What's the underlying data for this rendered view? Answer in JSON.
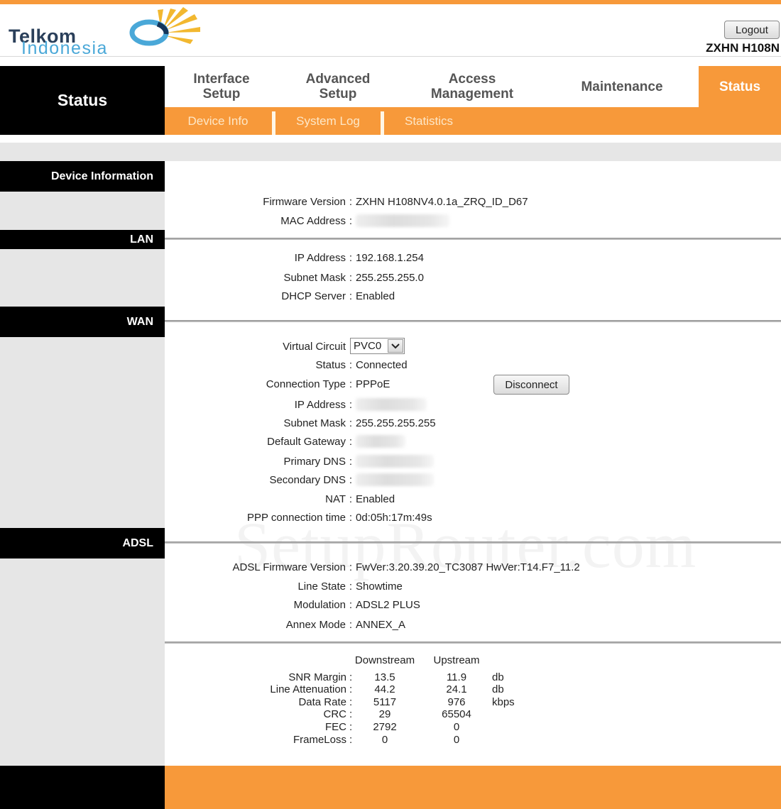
{
  "brand": {
    "line1": "Telkom",
    "line2": "Indonesia",
    "colors": {
      "orange": "#f7993a",
      "black": "#000000",
      "gray_panel": "#e6e6e6",
      "logo_dark": "#2a3f5a",
      "logo_blue": "#4aa8d8",
      "logo_sun": "#f2b830"
    }
  },
  "header": {
    "logout_label": "Logout",
    "model": "ZXHN H108N"
  },
  "nav": {
    "section_title": "Status",
    "tabs": [
      {
        "label": "Interface\nSetup",
        "active": false
      },
      {
        "label": "Advanced\nSetup",
        "active": false
      },
      {
        "label": "Access\nManagement",
        "active": false
      },
      {
        "label": "Maintenance",
        "active": false
      },
      {
        "label": "Status",
        "active": true
      }
    ],
    "subtabs": [
      {
        "label": "Device Info"
      },
      {
        "label": "System Log"
      },
      {
        "label": "Statistics"
      }
    ]
  },
  "sections": {
    "device_information": "Device Information",
    "lan": "LAN",
    "wan": "WAN",
    "adsl": "ADSL"
  },
  "device": {
    "firmware_label": "Firmware Version",
    "firmware_value": "ZXHN H108NV4.0.1a_ZRQ_ID_D67",
    "mac_label": "MAC Address",
    "mac_value": "(blurred)"
  },
  "lan": {
    "ip_label": "IP Address",
    "ip_value": "192.168.1.254",
    "mask_label": "Subnet Mask",
    "mask_value": "255.255.255.0",
    "dhcp_label": "DHCP Server",
    "dhcp_value": "Enabled"
  },
  "wan": {
    "vc_label": "Virtual Circuit",
    "vc_selected": "PVC0",
    "status_label": "Status",
    "status_value": "Connected",
    "conn_type_label": "Connection Type",
    "conn_type_value": "PPPoE",
    "disconnect_label": "Disconnect",
    "ip_label": "IP Address",
    "ip_value": "(blurred)",
    "mask_label": "Subnet Mask",
    "mask_value": "255.255.255.255",
    "gateway_label": "Default Gateway",
    "gateway_value": "(blurred)",
    "dns1_label": "Primary DNS",
    "dns1_value": "(blurred)",
    "dns2_label": "Secondary DNS",
    "dns2_value": "(blurred)",
    "nat_label": "NAT",
    "nat_value": "Enabled",
    "ppp_time_label": "PPP connection time",
    "ppp_time_value": "0d:05h:17m:49s"
  },
  "adsl": {
    "fw_label": "ADSL Firmware Version",
    "fw_value": "FwVer:3.20.39.20_TC3087 HwVer:T14.F7_11.2",
    "line_state_label": "Line State",
    "line_state_value": "Showtime",
    "modulation_label": "Modulation",
    "modulation_value": "ADSL2 PLUS",
    "annex_label": "Annex Mode",
    "annex_value": "ANNEX_A",
    "stats": {
      "headers": [
        "Downstream",
        "Upstream"
      ],
      "rows": [
        {
          "label": "SNR Margin",
          "down": "13.5",
          "up": "11.9",
          "unit": "db"
        },
        {
          "label": "Line Attenuation",
          "down": "44.2",
          "up": "24.1",
          "unit": "db"
        },
        {
          "label": "Data Rate",
          "down": "5117",
          "up": "976",
          "unit": "kbps"
        },
        {
          "label": "CRC",
          "down": "29",
          "up": "65504",
          "unit": ""
        },
        {
          "label": "FEC",
          "down": "2792",
          "up": "0",
          "unit": ""
        },
        {
          "label": "FrameLoss",
          "down": "0",
          "up": "0",
          "unit": ""
        }
      ]
    }
  },
  "watermark": "SetupRouter.com",
  "colon": ":"
}
